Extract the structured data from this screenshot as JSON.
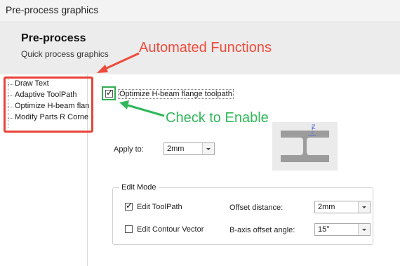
{
  "window": {
    "title": "Pre-process graphics"
  },
  "header": {
    "title": "Pre-process",
    "subtitle": "Quick process graphics"
  },
  "tree": {
    "items": [
      "Draw Text",
      "Adaptive ToolPath",
      "Optimize H-beam flan",
      "Modify Parts R Corne"
    ]
  },
  "annotations": {
    "automated": "Automated Functions",
    "check": "Check to Enable"
  },
  "options": {
    "optimize_label": "Optimize H-beam flange toolpath",
    "optimize_checked": true,
    "apply_to_label": "Apply to:",
    "apply_to_value": "2mm"
  },
  "edit_mode": {
    "title": "Edit Mode",
    "edit_toolpath": {
      "label": "Edit ToolPath",
      "checked": true
    },
    "edit_contour": {
      "label": "Edit Contour Vector",
      "checked": false
    },
    "offset_distance": {
      "label": "Offset distance:",
      "value": "2mm"
    },
    "baxis_angle": {
      "label": "B-axis offset angle:",
      "value": "15°"
    }
  },
  "illustration": {
    "axis_label": "Z"
  },
  "colors": {
    "annotation_red": "#ef4b3b",
    "annotation_green": "#30b75a",
    "header_bg": "#ececec"
  }
}
